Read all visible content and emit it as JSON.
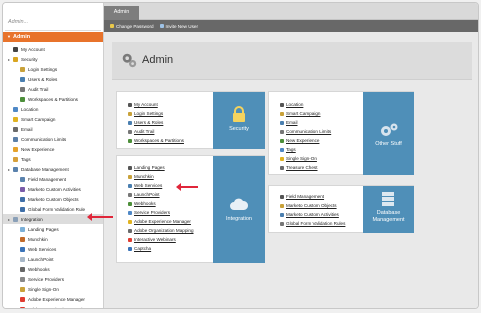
{
  "sidebar": {
    "search_placeholder": "Admin...",
    "root_label": "Admin",
    "items": [
      {
        "label": "My Account",
        "color": "#444"
      },
      {
        "label": "Security",
        "color": "#d9a520"
      },
      {
        "label": "Login Settings",
        "color": "#c9a23a"
      },
      {
        "label": "Users & Roles",
        "color": "#4a7fb0"
      },
      {
        "label": "Audit Trail",
        "color": "#777"
      },
      {
        "label": "Workspaces & Partitions",
        "color": "#4d8f3a"
      },
      {
        "label": "Location",
        "color": "#4f88c6"
      },
      {
        "label": "Smart Campaign",
        "color": "#e1b321"
      },
      {
        "label": "Email",
        "color": "#6a6a6a"
      },
      {
        "label": "Communication Limits",
        "color": "#5b7fa8"
      },
      {
        "label": "New Experience",
        "color": "#e6a22a"
      },
      {
        "label": "Tags",
        "color": "#d7a03a"
      },
      {
        "label": "Database Management",
        "color": "#5a82ad"
      },
      {
        "label": "Field Management",
        "color": "#5a82ad"
      },
      {
        "label": "Marketo Custom Activities",
        "color": "#7a5ba8"
      },
      {
        "label": "Marketo Custom Objects",
        "color": "#3f6fa8"
      },
      {
        "label": "Global Form Validation Rule",
        "color": "#3f6fa8"
      },
      {
        "label": "Integration",
        "color": "#8aa0b8"
      },
      {
        "label": "Landing Pages",
        "color": "#7bb0d8"
      },
      {
        "label": "Munchkin",
        "color": "#c26a2a"
      },
      {
        "label": "Web Services",
        "color": "#3a73b8"
      },
      {
        "label": "LaunchPoint",
        "color": "#a8b8c8"
      },
      {
        "label": "Webhooks",
        "color": "#666"
      },
      {
        "label": "Service Providers",
        "color": "#888"
      },
      {
        "label": "Single Sign-On",
        "color": "#c9a23a"
      },
      {
        "label": "Adobe Experience Manager",
        "color": "#e03c31"
      },
      {
        "label": "Adobe Organization Mapping",
        "color": "#e03c31"
      }
    ]
  },
  "topbar": {
    "tab": "Admin"
  },
  "toolbar": {
    "change_password": "Change Password",
    "invite_user": "Invite New User"
  },
  "page": {
    "title": "Admin"
  },
  "cards": {
    "security": {
      "badge": "Security",
      "links": [
        "My Account",
        "Login Settings",
        "Users & Roles",
        "Audit Trail",
        "Workspaces & Partitions"
      ]
    },
    "other": {
      "badge": "Other Stuff",
      "links": [
        "Location",
        "Smart Campaign",
        "Email",
        "Communication Limits",
        "New Experience",
        "Tags",
        "Single Sign-On",
        "Treasure Chest"
      ]
    },
    "integration": {
      "badge": "Integration",
      "links": [
        "Landing Pages",
        "Munchkin",
        "Web Services",
        "LaunchPoint",
        "Webhooks",
        "Service Providers",
        "Adobe Experience Manager",
        "Adobe Organization Mapping",
        "Interactive Webinars",
        "Captcha"
      ]
    },
    "database": {
      "badge_line1": "Database",
      "badge_line2": "Management",
      "links": [
        "Field Management",
        "Marketo Custom Objects",
        "Marketo Custom Activities",
        "Global Form Validation Rules"
      ]
    }
  },
  "colors": {
    "accent": "#e8732b",
    "badge": "#4f8fb8",
    "arrow": "#e0263a"
  }
}
